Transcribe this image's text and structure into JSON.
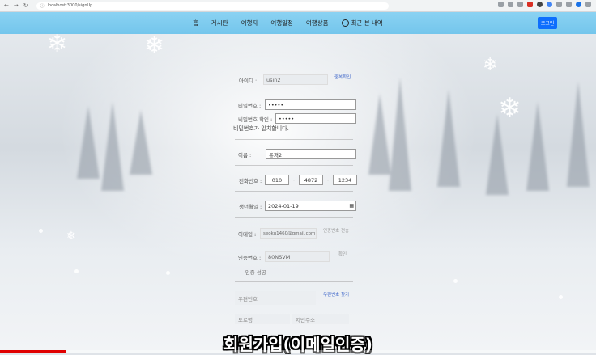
{
  "browser": {
    "url": "localhost:3000/signUp"
  },
  "navbar": {
    "items": [
      "홈",
      "게시판",
      "여행지",
      "여행일정",
      "여행상품",
      "최근 본 내역"
    ],
    "logout": "로그인"
  },
  "form": {
    "id_label": "아이디 :",
    "id_value": "usin2",
    "id_check": "중복확인",
    "pw_label": "비밀번호 :",
    "pw_value": "•••••",
    "pw_confirm_label": "비밀번호 확인 :",
    "pw_confirm_value": "•••••",
    "pw_mismatch": "비밀번호가 일치합니다.",
    "name_label": "이름 :",
    "name_value": "유저2",
    "phone_label": "전화번호 :",
    "phone_1": "010",
    "phone_2": "4872",
    "phone_3": "1234",
    "birth_label": "생년월일 :",
    "birth_value": "2024-01-19",
    "email_label": "이메일 :",
    "email_value": "seoku1460@gmail.com",
    "email_send": "인증번호 전송",
    "code_label": "인증번호 :",
    "code_value": "80NSVM",
    "code_confirm": "확인",
    "code_status": "----- 인증 성공 -----",
    "postcode_placeholder": "우편번호",
    "postcode_find": "우편번호 찾기",
    "road_placeholder": "도로명",
    "jibun_placeholder": "지번주소"
  },
  "subtitle": "회원가입(이메일인증)",
  "video_progress": 0.11
}
